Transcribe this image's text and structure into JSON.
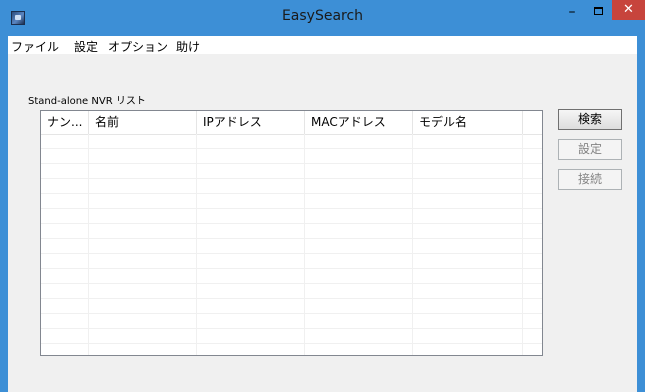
{
  "window": {
    "title": "EasySearch",
    "minimize_glyph": "–",
    "close_glyph": "✕"
  },
  "menu": [
    {
      "label": "ファイル"
    },
    {
      "label": "設定"
    },
    {
      "label": "オプション"
    },
    {
      "label": "助け"
    }
  ],
  "list": {
    "label": "Stand-alone NVR リスト",
    "columns": [
      "ナン...",
      "名前",
      "IPアドレス",
      "MACアドレス",
      "モデル名"
    ],
    "rows": []
  },
  "buttons": {
    "search": "検索",
    "settings": "設定",
    "connect": "接続"
  },
  "colors": {
    "titlebar": "#3d8fd6",
    "close_button": "#c7443c",
    "client_background": "#f0f0f0"
  }
}
